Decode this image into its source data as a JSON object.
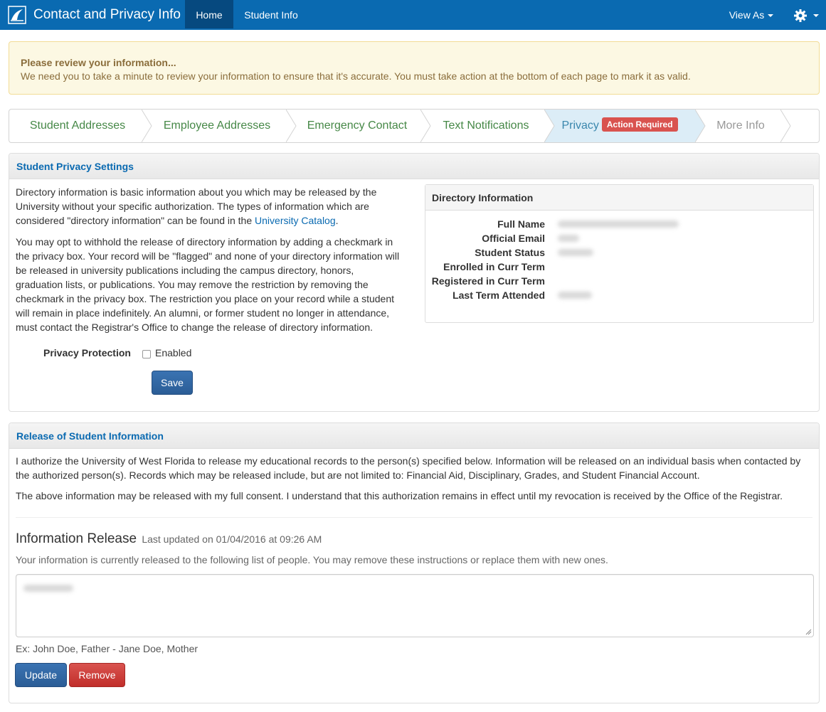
{
  "navbar": {
    "title": "Contact and Privacy Info",
    "home": "Home",
    "student_info": "Student Info",
    "view_as": "View As",
    "color": "#0a6ab1"
  },
  "alert": {
    "title": "Please review your information...",
    "text": "We need you to take a minute to review your information to ensure that it's accurate. You must take action at the bottom of each page to mark it as valid."
  },
  "steps": [
    {
      "label": "Student Addresses"
    },
    {
      "label": "Employee Addresses"
    },
    {
      "label": "Emergency Contact"
    },
    {
      "label": "Text Notifications"
    },
    {
      "label": "Privacy",
      "badge": "Action Required"
    },
    {
      "label": "More Info"
    }
  ],
  "privacy_panel": {
    "heading": "Student Privacy Settings",
    "para1_text": "Directory information is basic information about you which may be released by the University without your specific authorization. The types of information which are considered \"directory information\" can be found in the ",
    "para1_link": "University Catalog",
    "para1_end": ".",
    "para2": "You may opt to withhold the release of directory information by adding a checkmark in the privacy box. Your record will be \"flagged\" and none of your directory information will be released in university publications including the campus directory, honors, graduation lists, or publications. You may remove the restriction by removing the checkmark in the privacy box. The restriction you place on your record while a student will remain in place indefinitely. An alumni, or former student no longer in attendance, must contact the Registrar's Office to change the release of directory information.",
    "protection_label": "Privacy Protection",
    "enabled_label": "Enabled",
    "save": "Save"
  },
  "directory": {
    "heading": "Directory Information",
    "rows": [
      {
        "label": "Full Name"
      },
      {
        "label": "Official Email"
      },
      {
        "label": "Student Status"
      },
      {
        "label": "Enrolled in Curr Term"
      },
      {
        "label": "Registered in Curr Term"
      },
      {
        "label": "Last Term Attended"
      }
    ]
  },
  "release_panel": {
    "heading": "Release of Student Information",
    "para1": "I authorize the University of West Florida to release my educational records to the person(s) specified below. Information will be released on an individual basis when contacted by the authorized person(s). Records which may be released include, but are not limited to: Financial Aid, Disciplinary, Grades, and Student Financial Account.",
    "para2": "The above information may be released with my full consent. I understand that this authorization remains in effect until my revocation is received by the Office of the Registrar.",
    "info_title": "Information Release",
    "last_updated": "Last updated on 01/04/2016 at 09:26 AM",
    "description": "Your information is currently released to the following list of people. You may remove these instructions or replace them with new ones.",
    "example": "Ex: John Doe, Father - Jane Doe, Mother",
    "update": "Update",
    "remove": "Remove"
  }
}
